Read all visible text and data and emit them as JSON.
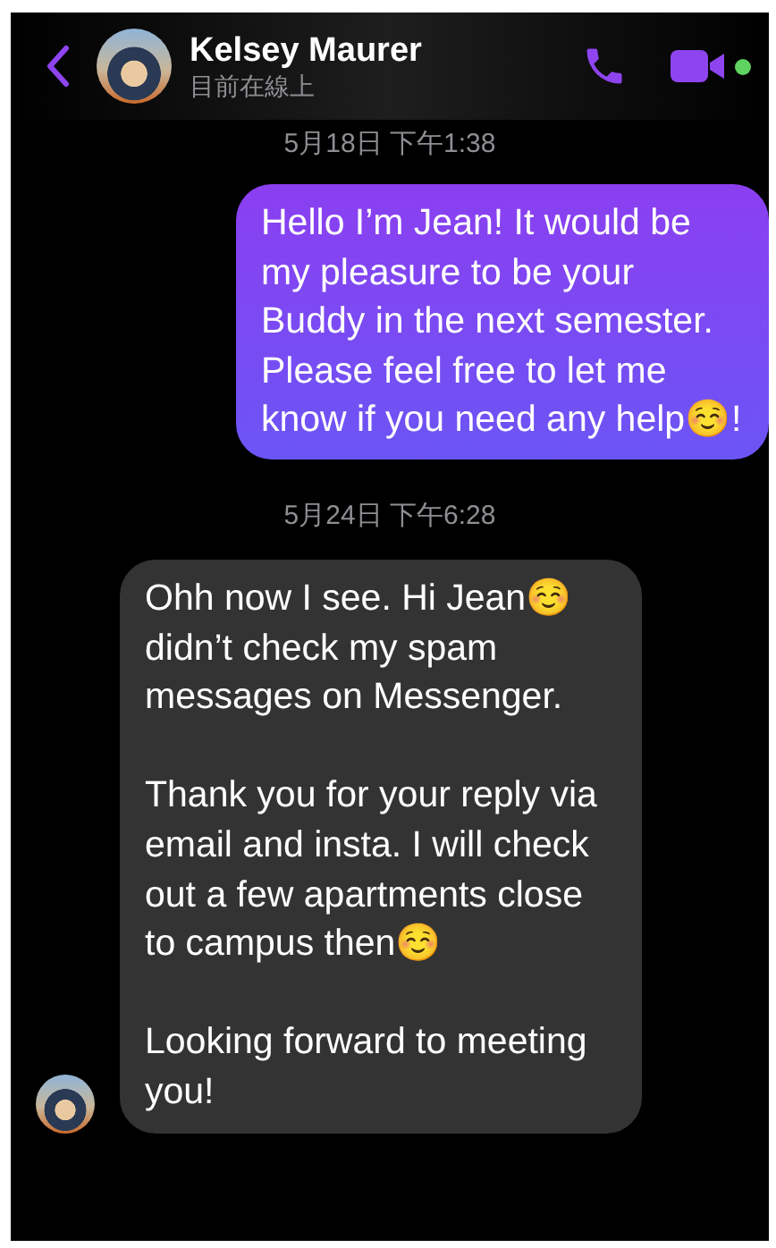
{
  "header": {
    "contact_name": "Kelsey Maurer",
    "status": "目前在線上",
    "online": true
  },
  "thread": [
    {
      "kind": "timestamp",
      "text": "5月18日 下午1:38"
    },
    {
      "kind": "sent",
      "paragraphs": [
        "Hello I’m Jean! It would be my pleasure to be your Buddy in the next semester. Please feel free to let me know if you need any help☺️!"
      ]
    },
    {
      "kind": "timestamp",
      "text": "5月24日 下午6:28"
    },
    {
      "kind": "received",
      "paragraphs": [
        "Ohh now I see. Hi Jean☺️ didn’t check my spam messages on Messenger.",
        "Thank you for your reply via email and insta. I will check out a few apartments close to campus then☺️",
        "Looking forward to meeting you!"
      ]
    }
  ]
}
